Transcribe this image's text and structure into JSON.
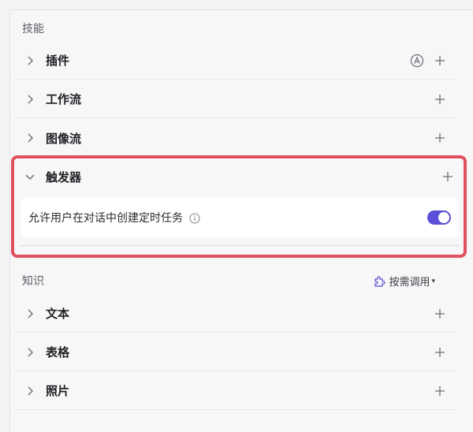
{
  "skills": {
    "title": "技能",
    "items": [
      {
        "label": "插件",
        "has_auto_badge": true
      },
      {
        "label": "工作流",
        "has_auto_badge": false
      },
      {
        "label": "图像流",
        "has_auto_badge": false
      }
    ],
    "trigger": {
      "label": "触发器",
      "setting_text": "允许用户在对话中创建定时任务",
      "toggle_on": true
    }
  },
  "knowledge": {
    "title": "知识",
    "mode_label": "按需调用",
    "items": [
      {
        "label": "文本"
      },
      {
        "label": "表格"
      },
      {
        "label": "照片"
      }
    ]
  },
  "colors": {
    "accent": "#5a4fd6",
    "highlight": "#e0515f"
  },
  "icons": {
    "expand": "chevron-right-icon",
    "collapse": "chevron-down-icon",
    "add": "plus-icon",
    "auto": "auto-badge-icon",
    "info": "info-icon",
    "ondemand": "puzzle-icon"
  }
}
